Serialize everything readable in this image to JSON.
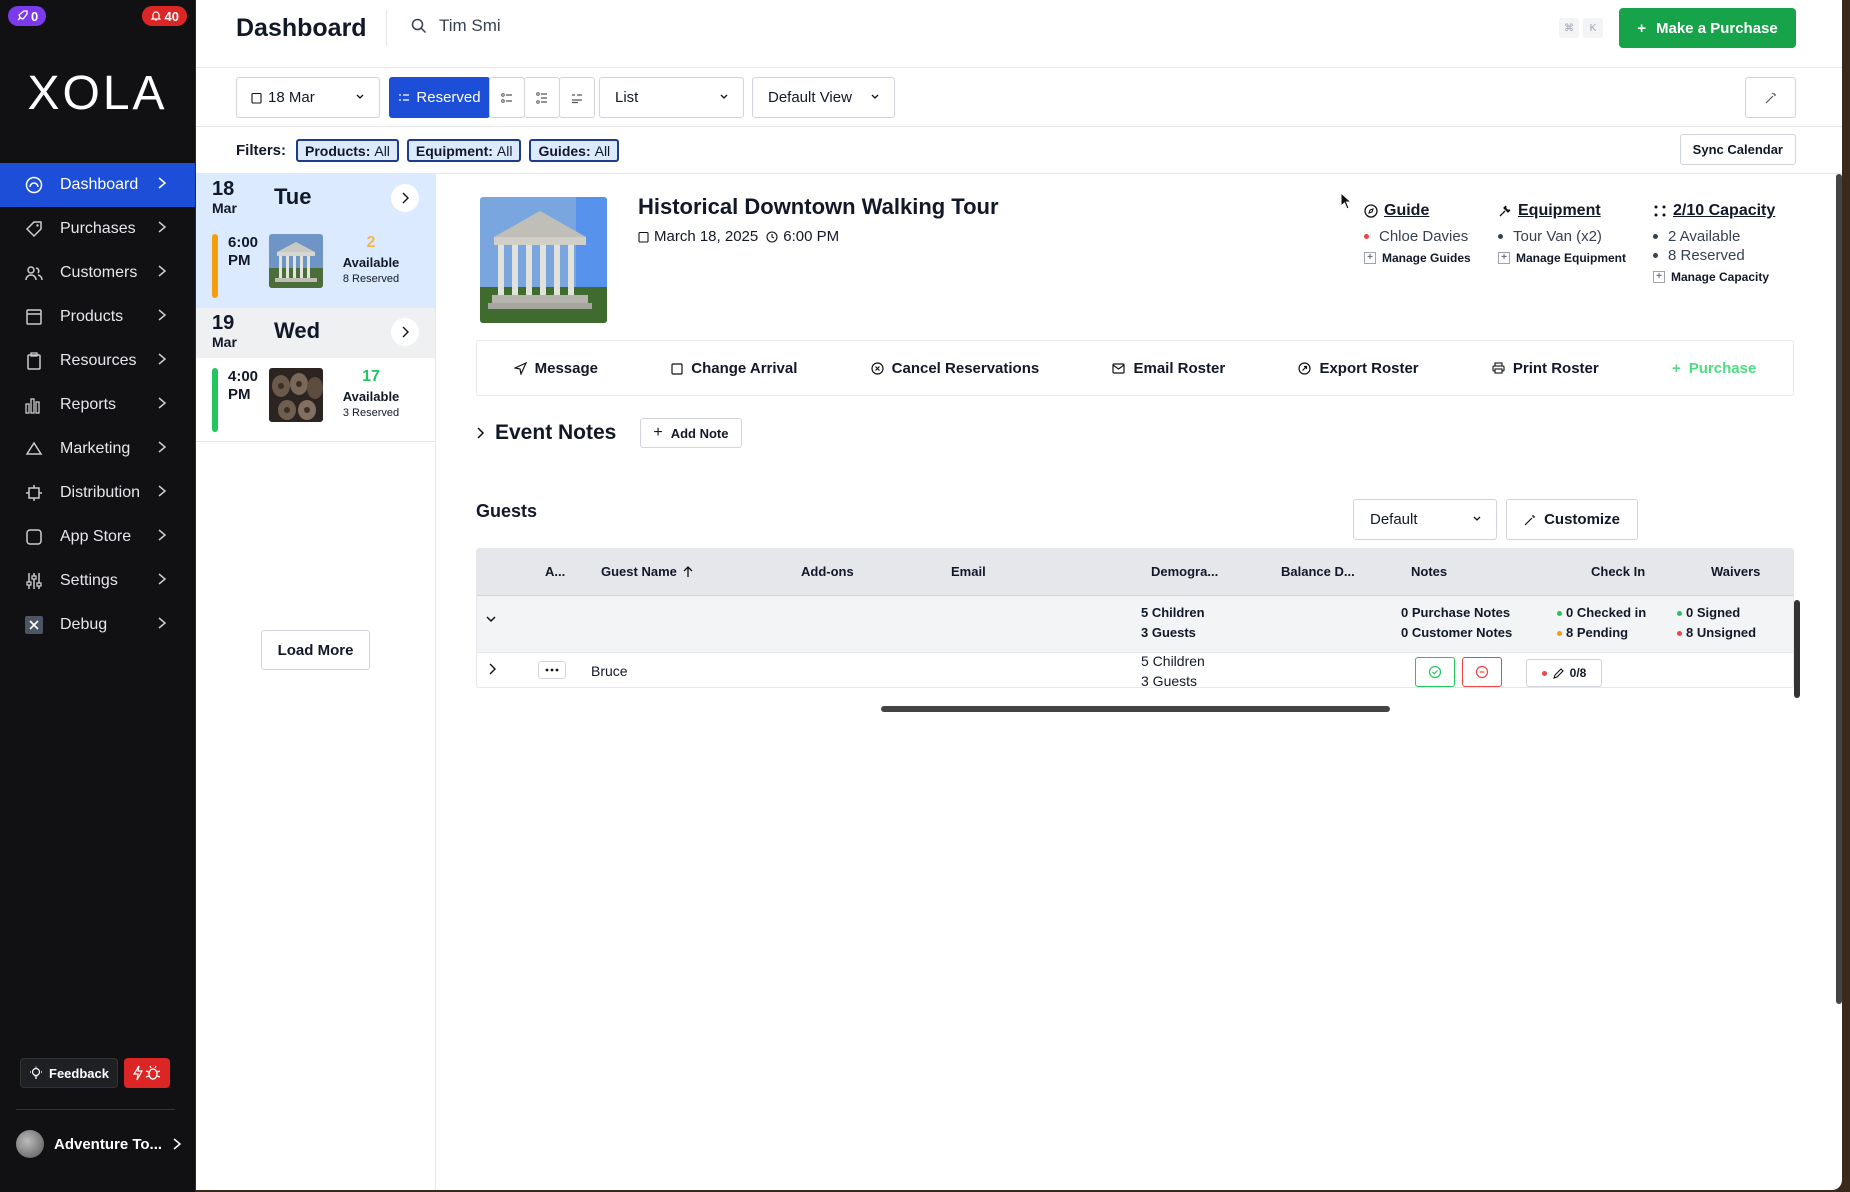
{
  "badges": {
    "notifications": "0",
    "alerts": "40"
  },
  "brand": {
    "logo": "XOLA"
  },
  "sidebar": {
    "items": [
      {
        "label": "Dashboard",
        "icon": "dashboard-icon"
      },
      {
        "label": "Purchases",
        "icon": "tag-icon"
      },
      {
        "label": "Customers",
        "icon": "users-icon"
      },
      {
        "label": "Products",
        "icon": "box-icon"
      },
      {
        "label": "Resources",
        "icon": "clipboard-icon"
      },
      {
        "label": "Reports",
        "icon": "bar-chart-icon"
      },
      {
        "label": "Marketing",
        "icon": "megaphone-icon"
      },
      {
        "label": "Distribution",
        "icon": "distribution-icon"
      },
      {
        "label": "App Store",
        "icon": "square-icon"
      },
      {
        "label": "Settings",
        "icon": "sliders-icon"
      },
      {
        "label": "Debug",
        "icon": "x-icon"
      }
    ],
    "feedback_label": "Feedback",
    "account_label": "Adventure To..."
  },
  "header": {
    "title": "Dashboard",
    "search_value": "Tim Smi",
    "shortcut_keys": [
      "⌘",
      "K"
    ],
    "make_purchase_label": "Make a Purchase"
  },
  "toolbar": {
    "date_label": "18 Mar",
    "reserved_label": "Reserved",
    "view_mode": "List",
    "saved_view": "Default View",
    "sync_label": "Sync Calendar"
  },
  "filters": {
    "label": "Filters:",
    "chips": [
      {
        "name": "Products:",
        "value": "All"
      },
      {
        "name": "Equipment:",
        "value": "All"
      },
      {
        "name": "Guides:",
        "value": "All"
      }
    ]
  },
  "days": [
    {
      "day_num": "18",
      "month": "Mar",
      "weekday": "Tue",
      "event": {
        "time": "6:00 PM",
        "available": "2",
        "available_label": "Available",
        "reserved": "8 Reserved",
        "bar_color": "#f59e0b",
        "num_color": "#f5b553"
      }
    },
    {
      "day_num": "19",
      "month": "Mar",
      "weekday": "Wed",
      "event": {
        "time": "4:00 PM",
        "available": "17",
        "available_label": "Available",
        "reserved": "3 Reserved",
        "bar_color": "#22c55e",
        "num_color": "#22c55e"
      }
    }
  ],
  "load_more_label": "Load More",
  "event": {
    "title": "Historical Downtown Walking Tour",
    "date": "March 18, 2025",
    "time": "6:00 PM",
    "guide": {
      "heading": "Guide",
      "name": "Chloe Davies",
      "manage": "Manage Guides"
    },
    "equipment": {
      "heading": "Equipment",
      "item": "Tour Van (x2)",
      "manage": "Manage Equipment"
    },
    "capacity": {
      "heading": "2/10 Capacity",
      "available": "2 Available",
      "reserved": "8 Reserved",
      "manage": "Manage Capacity"
    }
  },
  "actions": [
    "Message",
    "Change Arrival",
    "Cancel Reservations",
    "Email Roster",
    "Export Roster",
    "Print Roster",
    "Purchase"
  ],
  "notes": {
    "title": "Event Notes",
    "add_label": "Add Note"
  },
  "guests": {
    "title": "Guests",
    "sort_view": "Default",
    "customize_label": "Customize",
    "columns": [
      "A...",
      "Guest Name",
      "Add-ons",
      "Email",
      "Demogra...",
      "Balance D...",
      "Notes",
      "Check In",
      "Waivers"
    ],
    "summary": {
      "demographics": [
        "5 Children",
        "3 Guests"
      ],
      "notes": [
        "0 Purchase Notes",
        "0 Customer Notes"
      ],
      "checkin": [
        "0 Checked in",
        "8 Pending"
      ],
      "waivers": [
        "0 Signed",
        "8 Unsigned"
      ]
    },
    "rows": [
      {
        "name": "Bruce",
        "demographics": [
          "5 Children",
          "3 Guests"
        ],
        "waivers": "0/8"
      }
    ]
  },
  "colors": {
    "accent": "#1d4ed8",
    "success": "#16a34a",
    "danger": "#dc2626",
    "warning": "#f59e0b"
  }
}
